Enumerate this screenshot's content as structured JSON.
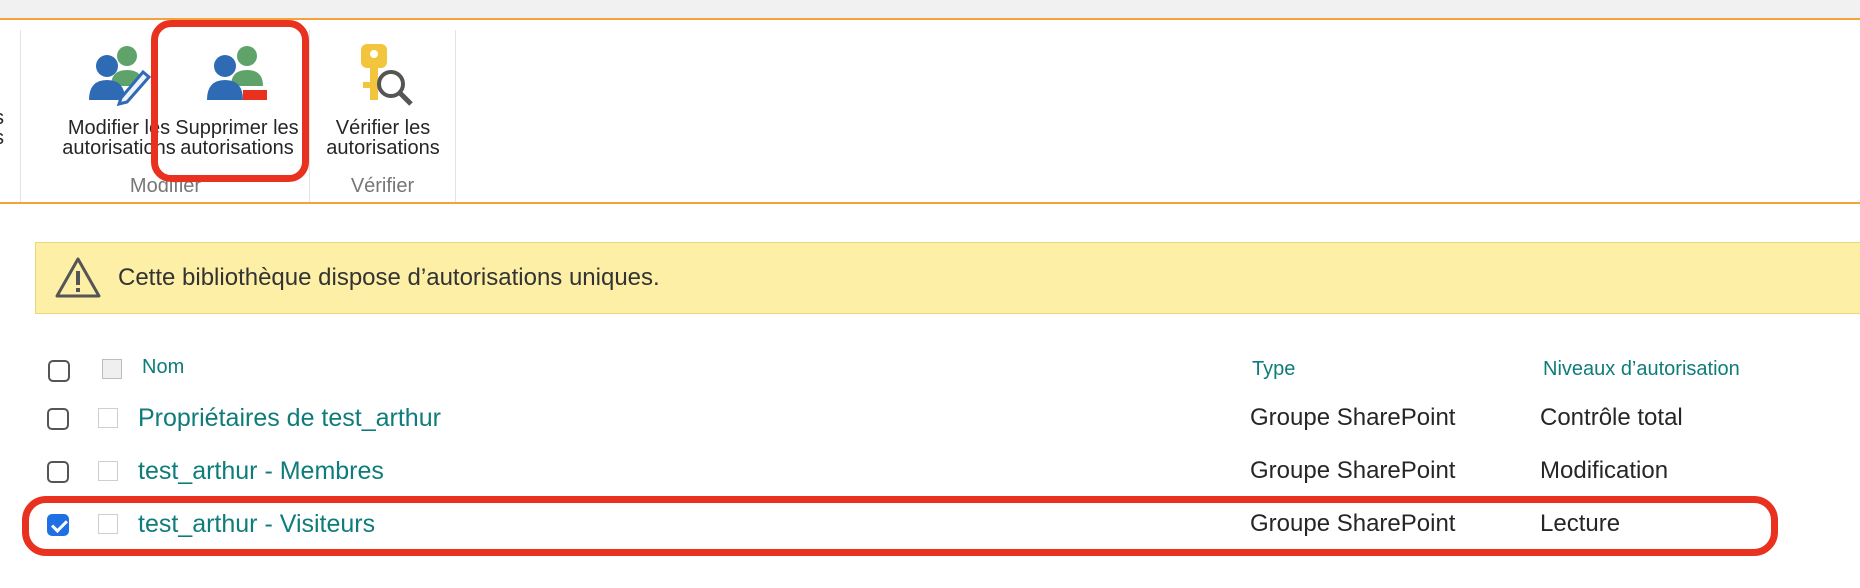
{
  "ribbon": {
    "cutoff_label": "s\ns",
    "buttons": {
      "modify": {
        "label": "Modifier les\nautorisations"
      },
      "remove": {
        "label": "Supprimer les\nautorisations"
      },
      "check": {
        "label": "Vérifier les\nautorisations"
      }
    },
    "groups": {
      "modify": "Modifier",
      "check": "Vérifier"
    }
  },
  "banner": {
    "text": "Cette bibliothèque dispose d’autorisations uniques."
  },
  "table": {
    "headers": {
      "name": "Nom",
      "type": "Type",
      "level": "Niveaux d’autorisation"
    },
    "rows": [
      {
        "name": "Propriétaires de test_arthur",
        "type": "Groupe SharePoint",
        "level": "Contrôle total",
        "checked": false
      },
      {
        "name": "test_arthur - Membres",
        "type": "Groupe SharePoint",
        "level": "Modification",
        "checked": false
      },
      {
        "name": "test_arthur - Visiteurs",
        "type": "Groupe SharePoint",
        "level": "Lecture",
        "checked": true
      }
    ]
  },
  "colors": {
    "accent": "#f2a33a",
    "link": "#0e7c7b",
    "highlight": "#e8321f",
    "banner": "#fdf0a6",
    "checkbox": "#1f6fe5"
  }
}
